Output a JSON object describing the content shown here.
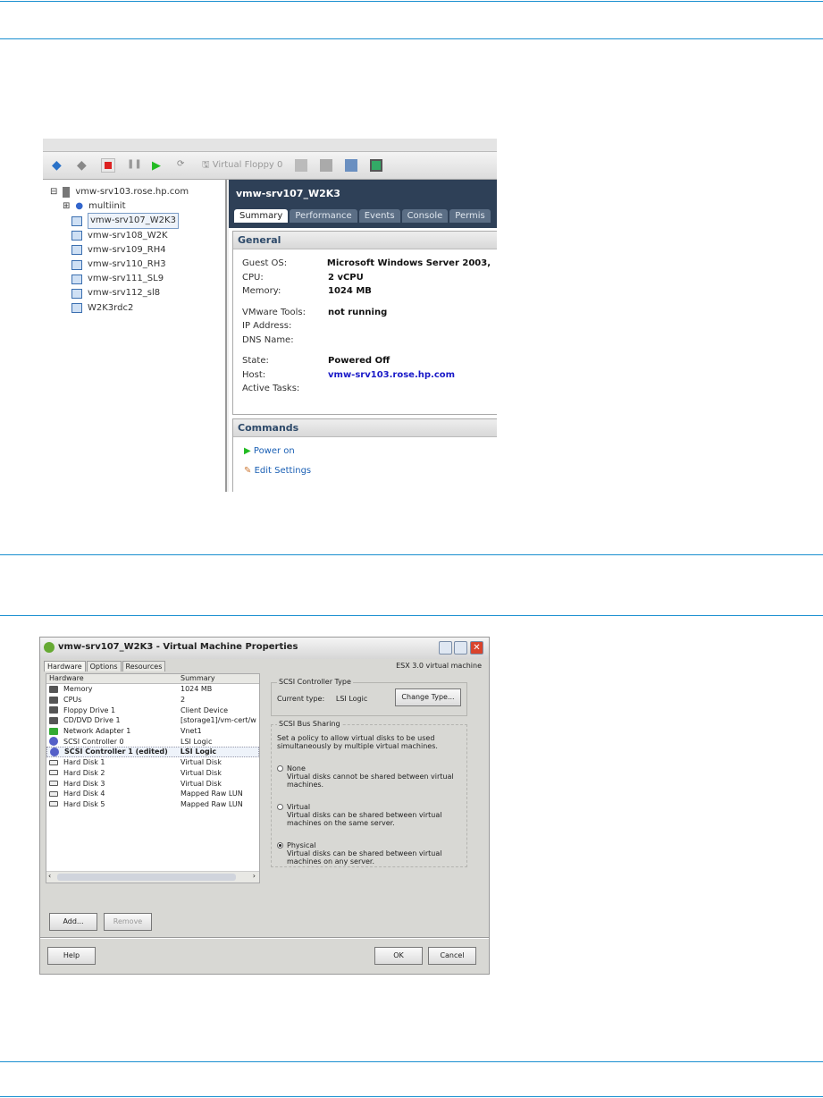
{
  "colors": {
    "rule": "#1a8fd0",
    "vm_header": "#2e4057",
    "link": "#1a1ac8"
  },
  "vsphere": {
    "toolbar": {
      "virtual_floppy_label": "Virtual Floppy 0",
      "icons": [
        "back-arrow-icon",
        "forward-arrow-icon",
        "stop-icon",
        "pause-icon",
        "play-icon",
        "reset-icon",
        "floppy-icon",
        "snapshot-icon",
        "revert-icon",
        "snapshot-manager-icon",
        "console-icon"
      ]
    },
    "tree": {
      "host": "vmw-srv103.rose.hp.com",
      "pool": "multiinit",
      "vms": [
        "vmw-srv107_W2K3",
        "vmw-srv108_W2K",
        "vmw-srv109_RH4",
        "vmw-srv110_RH3",
        "vmw-srv111_SL9",
        "vmw-srv112_sl8",
        "W2K3rdc2"
      ],
      "selected": "vmw-srv107_W2K3"
    },
    "vm_title": "vmw-srv107_W2K3",
    "tabs": [
      "Summary",
      "Performance",
      "Events",
      "Console",
      "Permis"
    ],
    "general": {
      "title": "General",
      "rows": [
        {
          "k": "Guest OS:",
          "v": "Microsoft Windows Server 2003,"
        },
        {
          "k": "CPU:",
          "v": "2 vCPU"
        },
        {
          "k": "Memory:",
          "v": "1024 MB"
        },
        {
          "k": "VMware Tools:",
          "v": "not running"
        },
        {
          "k": "IP Address:",
          "v": ""
        },
        {
          "k": "DNS Name:",
          "v": ""
        },
        {
          "k": "State:",
          "v": "Powered Off"
        },
        {
          "k": "Host:",
          "v": "vmw-srv103.rose.hp.com"
        },
        {
          "k": "Active Tasks:",
          "v": ""
        }
      ]
    },
    "commands": {
      "title": "Commands",
      "power_on": "Power on",
      "edit_settings": "Edit Settings"
    }
  },
  "dialog": {
    "title": "vmw-srv107_W2K3 - Virtual Machine Properties",
    "tabs": [
      "Hardware",
      "Options",
      "Resources"
    ],
    "version": "ESX 3.0 virtual machine",
    "columns": [
      "Hardware",
      "Summary"
    ],
    "rows": [
      {
        "hw": "Memory",
        "sum": "1024 MB",
        "icon": "memory-icon"
      },
      {
        "hw": "CPUs",
        "sum": "2",
        "icon": "cpu-icon"
      },
      {
        "hw": "Floppy Drive 1",
        "sum": "Client Device",
        "icon": "floppy-icon"
      },
      {
        "hw": "CD/DVD Drive 1",
        "sum": "[storage1]/vm-cert/w",
        "icon": "cdrom-icon"
      },
      {
        "hw": "Network Adapter 1",
        "sum": "Vnet1",
        "icon": "network-icon"
      },
      {
        "hw": "SCSI Controller 0",
        "sum": "LSI Logic",
        "icon": "scsi-icon"
      },
      {
        "hw": "SCSI Controller 1 (edited)",
        "sum": "LSI Logic",
        "icon": "scsi-icon"
      },
      {
        "hw": "Hard Disk 1",
        "sum": "Virtual Disk",
        "icon": "disk-icon"
      },
      {
        "hw": "Hard Disk 2",
        "sum": "Virtual Disk",
        "icon": "disk-icon"
      },
      {
        "hw": "Hard Disk 3",
        "sum": "Virtual Disk",
        "icon": "disk-icon"
      },
      {
        "hw": "Hard Disk 4",
        "sum": "Mapped Raw LUN",
        "icon": "disk-icon"
      },
      {
        "hw": "Hard Disk 5",
        "sum": "Mapped Raw LUN",
        "icon": "disk-icon"
      }
    ],
    "selected_row": "SCSI Controller 1 (edited)",
    "controller_type": {
      "legend": "SCSI Controller Type",
      "label": "Current type:",
      "value": "LSI Logic",
      "change": "Change Type..."
    },
    "bus_sharing": {
      "legend": "SCSI Bus Sharing",
      "desc": "Set a policy to allow virtual disks to be used simultaneously by multiple virtual machines.",
      "options": [
        {
          "label": "None",
          "desc": "Virtual disks cannot be shared between virtual machines.",
          "checked": false
        },
        {
          "label": "Virtual",
          "desc": "Virtual disks can be shared between virtual machines on the same server.",
          "checked": false
        },
        {
          "label": "Physical",
          "desc": "Virtual disks can be shared between virtual machines on any server.",
          "checked": true
        }
      ]
    },
    "buttons": {
      "add": "Add...",
      "remove": "Remove",
      "help": "Help",
      "ok": "OK",
      "cancel": "Cancel"
    }
  }
}
